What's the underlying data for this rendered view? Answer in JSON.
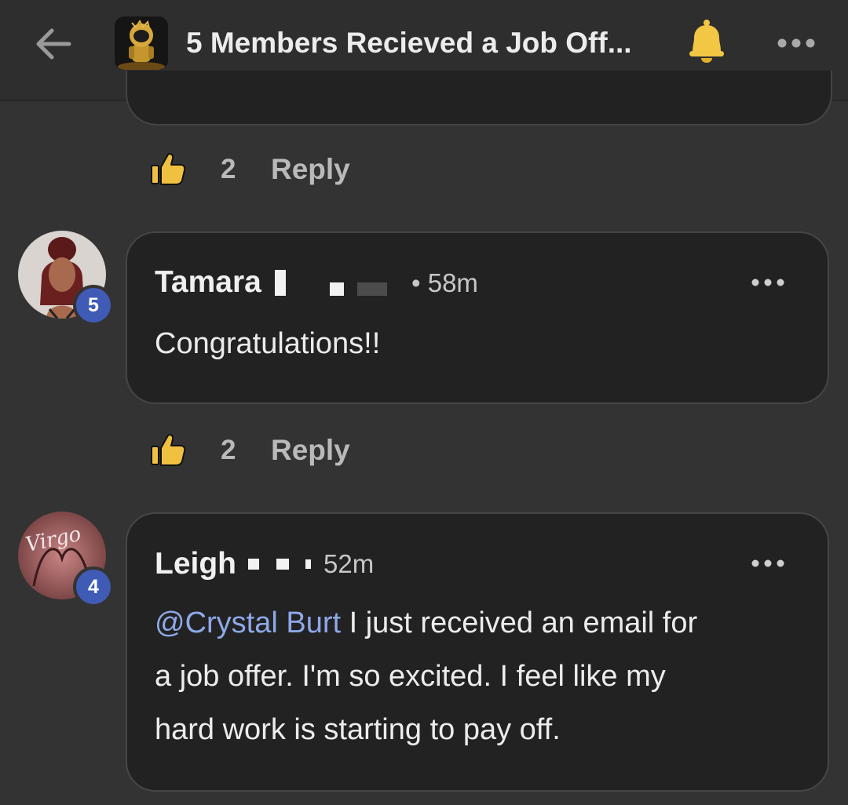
{
  "header": {
    "title": "5 Members Recieved a Job Off...",
    "back_icon": "arrow-left-icon",
    "bell_icon": "bell-icon",
    "more_icon": "more-horizontal-icon"
  },
  "colors": {
    "background": "#333333",
    "bubble": "#222222",
    "badge": "#3f5bb5",
    "mention": "#8ea8e8",
    "like": "#f0c040"
  },
  "comments": [
    {
      "likes": "2",
      "reply_label": "Reply"
    },
    {
      "author": "Tamara",
      "time": "• 58m",
      "level": "5",
      "text": "Congratulations!!",
      "likes": "2",
      "reply_label": "Reply"
    },
    {
      "author": "Leigh",
      "time": "52m",
      "level": "4",
      "avatar_text": "Virgo",
      "mention": "@Crystal Burt",
      "line1": " I just received an email for",
      "line2": "a job offer. I'm so excited. I feel like my",
      "line3": "hard work is starting to pay off."
    }
  ]
}
